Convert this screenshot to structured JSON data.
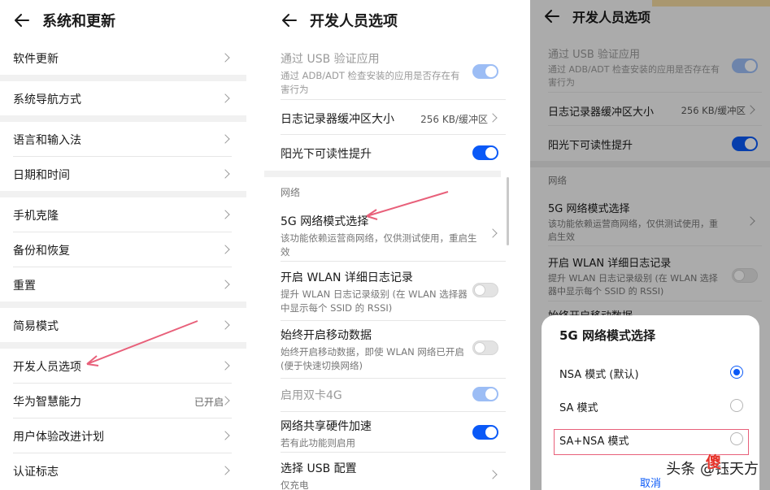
{
  "panel1": {
    "title": "系统和更新",
    "items": [
      {
        "label": "软件更新"
      },
      {
        "label": "系统导航方式"
      },
      {
        "label": "语言和输入法"
      },
      {
        "label": "日期和时间"
      },
      {
        "label": "手机克隆"
      },
      {
        "label": "备份和恢复"
      },
      {
        "label": "重置"
      },
      {
        "label": "简易模式"
      },
      {
        "label": "开发人员选项"
      },
      {
        "label": "华为智慧能力",
        "value": "已开启"
      },
      {
        "label": "用户体验改进计划"
      },
      {
        "label": "认证标志"
      }
    ]
  },
  "panel2": {
    "title": "开发人员选项",
    "usb_debug": {
      "title": "通过 USB 验证应用",
      "desc": "通过 ADB/ADT 检查安装的应用是否存在有害行为"
    },
    "log_buffer": {
      "title": "日志记录器缓冲区大小",
      "value": "256 KB/缓冲区"
    },
    "sunlight": {
      "title": "阳光下可读性提升"
    },
    "section_network": "网络",
    "mode5g": {
      "title": "5G 网络模式选择",
      "desc": "该功能依赖运营商网络，仅供测试使用，重启生效"
    },
    "wlan_log": {
      "title": "开启 WLAN 详细日志记录",
      "desc": "提升 WLAN 日志记录级别 (在 WLAN 选择器中显示每个 SSID 的 RSSI)"
    },
    "mobile_data": {
      "title": "始终开启移动数据",
      "desc": "始终开启移动数据，即使 WLAN 网络已开启 (便于快速切换网络)"
    },
    "dual4g": {
      "title": "启用双卡4G"
    },
    "tether": {
      "title": "网络共享硬件加速",
      "desc": "若有此功能则启用"
    },
    "usb_config": {
      "title": "选择 USB 配置",
      "desc": "仅充电"
    }
  },
  "panel3": {
    "title": "开发人员选项",
    "usb_debug": {
      "title": "通过 USB 验证应用",
      "desc": "通过 ADB/ADT 检查安装的应用是否存在有害行为"
    },
    "log_buffer": {
      "title": "日志记录器缓冲区大小",
      "value": "256 KB/缓冲区"
    },
    "sunlight": {
      "title": "阳光下可读性提升"
    },
    "section_network": "网络",
    "mode5g": {
      "title": "5G 网络模式选择",
      "desc": "该功能依赖运营商网络，仅供测试使用，重启生效"
    },
    "wlan_log": {
      "title": "开启 WLAN 详细日志记录",
      "desc": "提升 WLAN 日志记录级别 (在 WLAN 选择器中显示每个 SSID 的 RSSI)"
    },
    "partial": "始终开启移动数据",
    "dialog": {
      "title": "5G 网络模式选择",
      "options": [
        {
          "label": "NSA 模式 (默认)",
          "selected": true
        },
        {
          "label": "SA 模式",
          "selected": false
        },
        {
          "label": "SA+NSA 模式",
          "selected": false
        }
      ],
      "cancel": "取消"
    },
    "watermark": "头条 @钰天方",
    "watermark_logo": "傻"
  },
  "colors": {
    "accent": "#0a59f7",
    "arrow": "#e8607a"
  }
}
